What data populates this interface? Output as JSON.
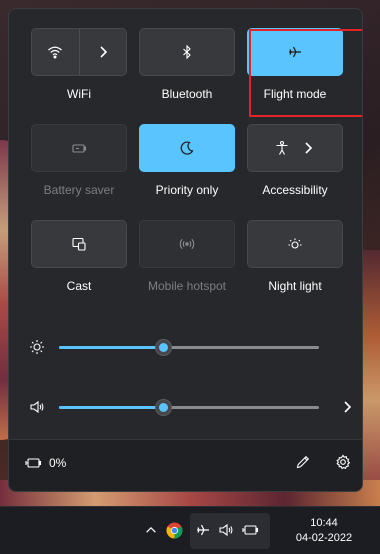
{
  "quick_settings": {
    "tiles": [
      {
        "id": "wifi",
        "label": "WiFi",
        "state": "off",
        "icon": "wifi-icon",
        "expand_icon": "chevron-right-icon"
      },
      {
        "id": "bluetooth",
        "label": "Bluetooth",
        "state": "off",
        "icon": "bluetooth-icon"
      },
      {
        "id": "flight_mode",
        "label": "Flight mode",
        "state": "on",
        "icon": "airplane-icon",
        "highlighted": true
      },
      {
        "id": "battery_saver",
        "label": "Battery saver",
        "state": "disabled",
        "icon": "battery-saver-icon"
      },
      {
        "id": "priority_only",
        "label": "Priority only",
        "state": "on",
        "icon": "moon-icon"
      },
      {
        "id": "accessibility",
        "label": "Accessibility",
        "state": "off",
        "icon": "accessibility-icon",
        "expand_icon": "chevron-right-icon"
      },
      {
        "id": "cast",
        "label": "Cast",
        "state": "off",
        "icon": "cast-icon"
      },
      {
        "id": "mobile_hotspot",
        "label": "Mobile hotspot",
        "state": "disabled",
        "icon": "hotspot-icon"
      },
      {
        "id": "night_light",
        "label": "Night light",
        "state": "off",
        "icon": "sun-icon"
      }
    ],
    "brightness": {
      "icon": "brightness-icon",
      "level": 0.4
    },
    "volume": {
      "icon": "speaker-icon",
      "level": 0.4,
      "expand_icon": "chevron-right-icon"
    },
    "footer": {
      "battery_percent": "0%",
      "battery_icon": "battery-charging-icon",
      "edit_icon": "pencil-icon",
      "settings_icon": "gear-icon"
    }
  },
  "taskbar": {
    "icons": [
      "chevron-up-icon",
      "chrome-icon",
      "airplane-icon",
      "speaker-icon",
      "battery-charging-icon"
    ],
    "time": "10:44",
    "date": "04-02-2022"
  },
  "colors": {
    "accent": "#5ac4ff",
    "highlight_box": "#e1232b",
    "panel": "#242528"
  }
}
